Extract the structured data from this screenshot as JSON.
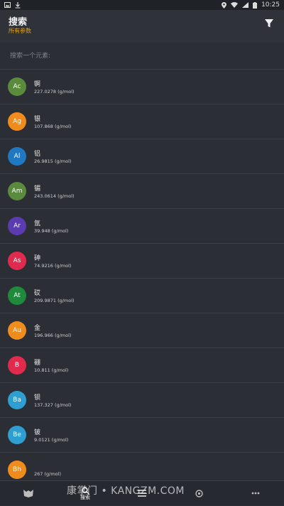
{
  "status_bar": {
    "time": "10:25"
  },
  "header": {
    "title": "搜索",
    "subtitle": "所有参数"
  },
  "search": {
    "placeholder": "搜索一个元素:"
  },
  "colors": {
    "background": "#2b2e34",
    "accent": "#e3a41b",
    "actinide": "#5a8a3c",
    "transition": "#f08c1c",
    "post_transition": "#1f78c1",
    "halogen": "#5b3bb0",
    "metalloid": "#e02a4e",
    "alkaline": "#2f9fd1"
  },
  "elements": [
    {
      "symbol": "Ac",
      "name": "锕",
      "weight": "227.0278 (g/mol)",
      "color": "#5a8a3c"
    },
    {
      "symbol": "Ag",
      "name": "银",
      "weight": "107.868 (g/mol)",
      "color": "#f08c1c"
    },
    {
      "symbol": "Al",
      "name": "铝",
      "weight": "26.9815 (g/mol)",
      "color": "#1f78c1"
    },
    {
      "symbol": "Am",
      "name": "镅",
      "weight": "243.0614 (g/mol)",
      "color": "#5a8a3c"
    },
    {
      "symbol": "Ar",
      "name": "氩",
      "weight": "39.948 (g/mol)",
      "color": "#5b3bb0"
    },
    {
      "symbol": "As",
      "name": "砷",
      "weight": "74.9216 (g/mol)",
      "color": "#e02a4e"
    },
    {
      "symbol": "At",
      "name": "砹",
      "weight": "209.9871 (g/mol)",
      "color": "#1f8a3c"
    },
    {
      "symbol": "Au",
      "name": "金",
      "weight": "196.966 (g/mol)",
      "color": "#f08c1c"
    },
    {
      "symbol": "B",
      "name": "硼",
      "weight": "10.811 (g/mol)",
      "color": "#e02a4e"
    },
    {
      "symbol": "Ba",
      "name": "钡",
      "weight": "137.327 (g/mol)",
      "color": "#2f9fd1"
    },
    {
      "symbol": "Be",
      "name": "铍",
      "weight": "9.0121 (g/mol)",
      "color": "#2f9fd1"
    },
    {
      "symbol": "Bh",
      "name": "",
      "weight": "267 (g/mol)",
      "color": "#f08c1c"
    }
  ],
  "bottom_nav": {
    "search_label": "搜索"
  },
  "watermark": "康掌门 • KANGZM.COM",
  "icons": {
    "filter": "filter-icon",
    "download": "download-icon",
    "image": "image-icon"
  }
}
